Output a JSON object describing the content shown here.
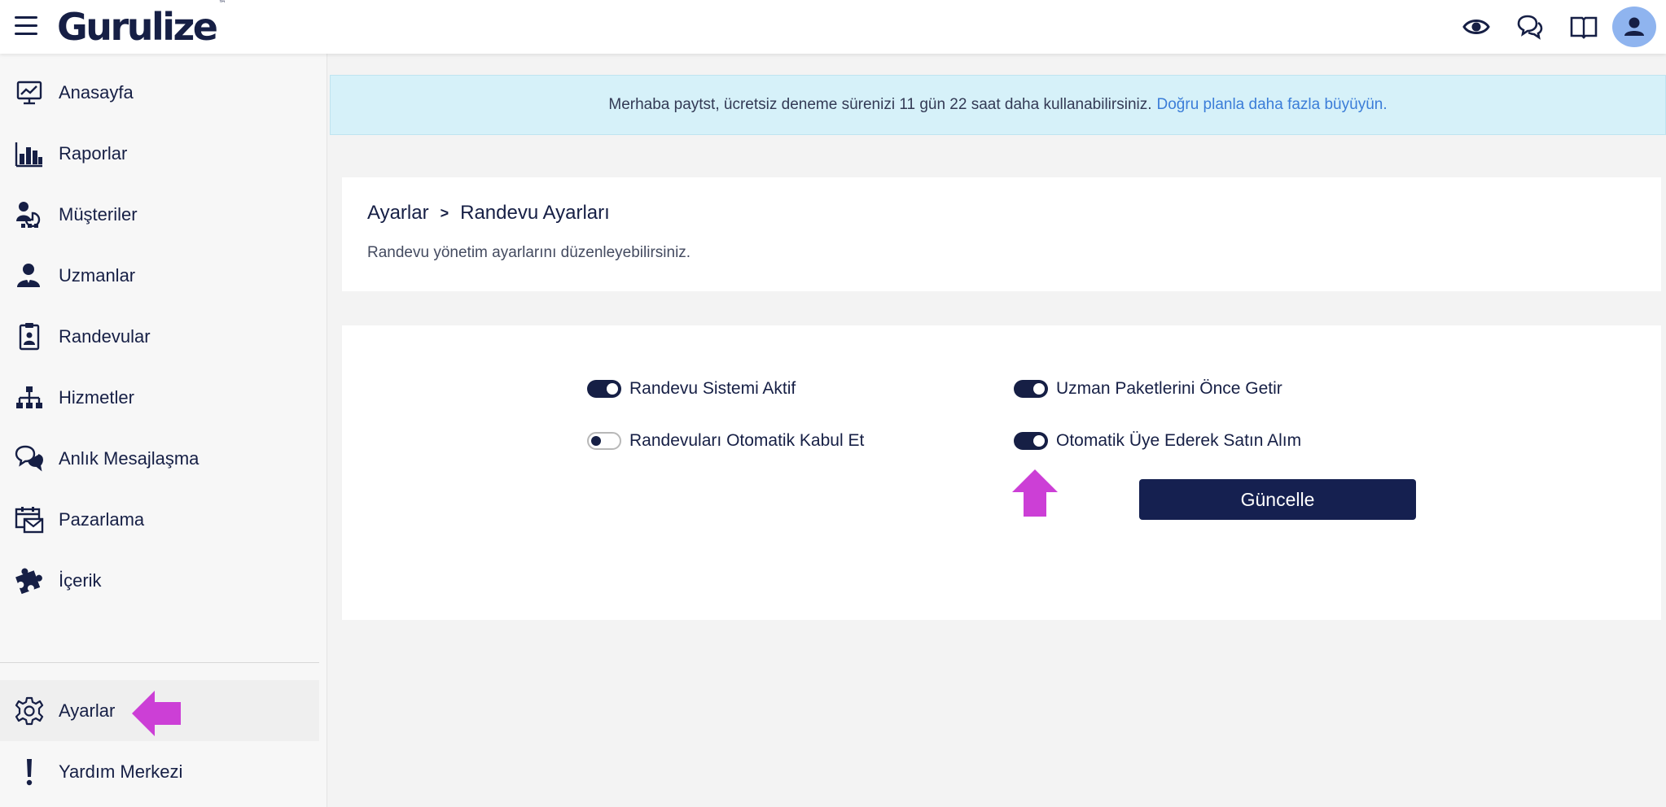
{
  "header": {
    "logo_text": "Gurulize",
    "logo_tm": "™",
    "icons": [
      "menu-icon",
      "eye-icon",
      "chat-icon",
      "book-icon",
      "user-icon"
    ]
  },
  "sidebar": {
    "items": [
      {
        "label": "Anasayfa",
        "icon": "monitor-chart-icon"
      },
      {
        "label": "Raporlar",
        "icon": "bar-chart-icon"
      },
      {
        "label": "Müşteriler",
        "icon": "customers-icon"
      },
      {
        "label": "Uzmanlar",
        "icon": "expert-icon"
      },
      {
        "label": "Randevular",
        "icon": "clipboard-icon"
      },
      {
        "label": "Hizmetler",
        "icon": "hierarchy-icon"
      },
      {
        "label": "Anlık Mesajlaşma",
        "icon": "chat-bubbles-icon"
      },
      {
        "label": "Pazarlama",
        "icon": "calendar-mail-icon"
      },
      {
        "label": "İçerik",
        "icon": "puzzle-icon"
      }
    ],
    "bottom_items": [
      {
        "label": "Ayarlar",
        "icon": "gear-icon"
      },
      {
        "label": "Yardım Merkezi",
        "icon": "exclamation-icon"
      }
    ]
  },
  "alert": {
    "text": "Merhaba paytst, ücretsiz deneme sürenizi 11 gün 22 saat daha kullanabilirsiniz.",
    "link": "Doğru planla daha fazla büyüyün."
  },
  "page": {
    "breadcrumb_root": "Ayarlar",
    "breadcrumb_sep": ">",
    "breadcrumb_current": "Randevu Ayarları",
    "description": "Randevu yönetim ayarlarını düzenleyebilirsiniz."
  },
  "settings": {
    "toggles": [
      {
        "label": "Randevu Sistemi Aktif",
        "on": true
      },
      {
        "label": "Randevuları Otomatik Kabul Et",
        "on": false
      },
      {
        "label": "Uzman Paketlerini Önce Getir",
        "on": true
      },
      {
        "label": "Otomatik Üye Ederek Satın Alım",
        "on": true
      }
    ],
    "update_label": "Güncelle"
  },
  "colors": {
    "brand": "#161f45",
    "alert_bg": "#d6f1f9",
    "link": "#3b7dd8",
    "annotation_arrow": "#cc3fd6",
    "avatar_bg": "#8fb4ef"
  }
}
